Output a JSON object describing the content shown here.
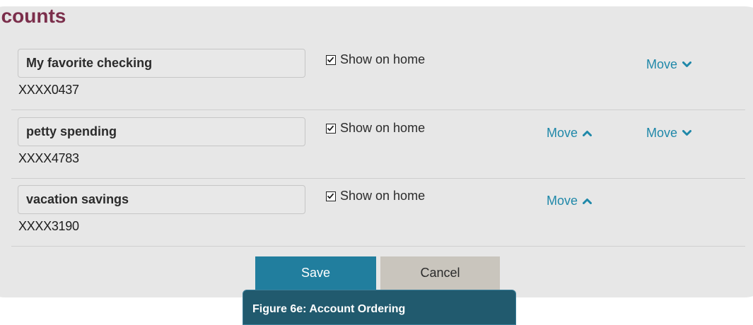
{
  "page": {
    "title": "ccounts",
    "caption": "Figure 6e: Account Ordering"
  },
  "colors": {
    "accent": "#1f88a9",
    "title": "#7b2e4b",
    "panel_background": "#e7e7e7",
    "save_button": "#217e9e",
    "cancel_button": "#c9c5bd",
    "caption_background": "#215a6e"
  },
  "accounts": [
    {
      "name": "My favorite checking",
      "number": "XXXX0437",
      "show_on_home_label": "Show on home",
      "show_on_home": true,
      "move_up_label": null,
      "move_down_label": "Move"
    },
    {
      "name": "petty spending",
      "number": "XXXX4783",
      "show_on_home_label": "Show on home",
      "show_on_home": true,
      "move_up_label": "Move",
      "move_down_label": "Move"
    },
    {
      "name": "vacation savings",
      "number": "XXXX3190",
      "show_on_home_label": "Show on home",
      "show_on_home": true,
      "move_up_label": "Move",
      "move_down_label": null
    }
  ],
  "actions": {
    "save_label": "Save",
    "cancel_label": "Cancel"
  },
  "icons": {
    "checkbox": "checkbox-checked-icon",
    "move_up": "chevron-up-icon",
    "move_down": "chevron-down-icon"
  }
}
